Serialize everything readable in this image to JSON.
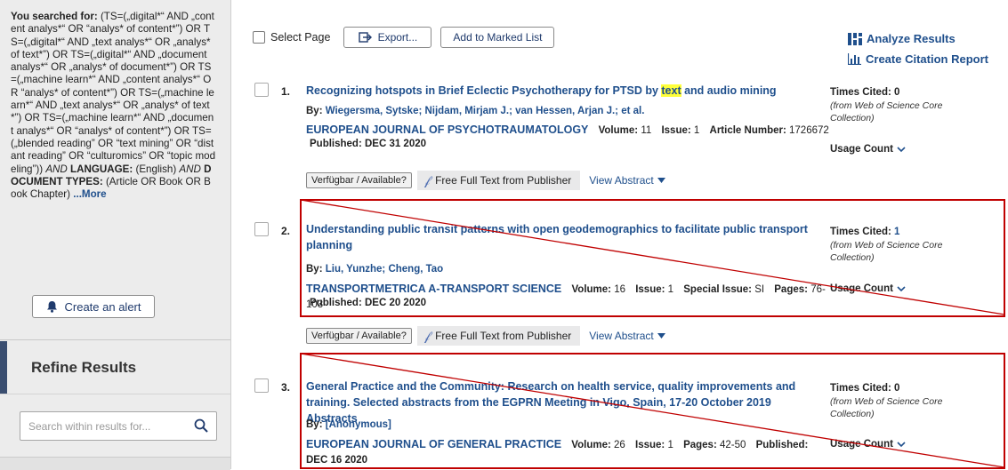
{
  "sidebar": {
    "search_label": "You searched for:",
    "query_parts": [
      {
        "t": " (TS=(„digital*“ AND „content analys*“ OR “analys* of content*”) OR TS=(„digital*“ AND „text analys*“ OR „analys* of text*”) OR TS=(„digital*“ AND „document analys*“ OR „analys* of document*”) OR TS=(„machine learn*“ AND „content analys*“ OR “analys* of content*”) OR TS=(„machine learn*“ AND „text analys*“ OR „analys* of text*”) OR TS=(„machine learn*“ AND „document analys*“ OR “analys* of content*”) OR TS=(„blended reading” OR “text mining” OR “distant reading” OR “culturomics” OR “topic modeling”)) ",
        "s": "n"
      },
      {
        "t": "AND",
        "s": "i"
      },
      {
        "t": " LANGUAGE: ",
        "s": "b"
      },
      {
        "t": "(English) ",
        "s": "n"
      },
      {
        "t": "AND",
        "s": "i"
      },
      {
        "t": " DOCUMENT TYPES: ",
        "s": "b"
      },
      {
        "t": "(Article OR Book OR Book Chapter) ",
        "s": "n"
      }
    ],
    "more_label": "...More",
    "alert_label": "Create an alert",
    "refine_title": "Refine Results",
    "search_placeholder": "Search within results for..."
  },
  "toolbar": {
    "select_page": "Select Page",
    "export_label": "Export...",
    "marked_list_label": "Add to Marked List",
    "analyze_label": "Analyze Results",
    "citation_label": "Create Citation Report"
  },
  "records": [
    {
      "num": "1.",
      "title_before": "Recognizing hotspots in Brief Eclectic Psychotherapy for PTSD by ",
      "title_highlight": "text",
      "title_after": " and audio mining",
      "by_label": "By:",
      "authors": "Wiegersma, Sytske; Nijdam, Mirjam J.; van Hessen, Arjan J.; et al.",
      "journal": "EUROPEAN JOURNAL OF PSYCHOTRAUMATOLOGY",
      "meta": [
        {
          "l": "Volume:",
          "v": "11"
        },
        {
          "l": "Issue:",
          "v": "1"
        },
        {
          "l": "Article Number:",
          "v": "1726672"
        }
      ],
      "published": "Published: DEC 31 2020",
      "times_cited_label": "Times Cited:",
      "times_cited": "0",
      "from": "(from Web of Science Core Collection)",
      "usage": "Usage Count"
    },
    {
      "num": "2.",
      "title": "Understanding public transit patterns with open geodemographics to facilitate public transport planning",
      "by_label": "By:",
      "authors": "Liu, Yunzhe; Cheng, Tao",
      "journal": "TRANSPORTMETRICA A-TRANSPORT SCIENCE",
      "meta": [
        {
          "l": "Volume:",
          "v": "16"
        },
        {
          "l": "Issue:",
          "v": "1"
        },
        {
          "l": "Special Issue:",
          "v": "SI"
        },
        {
          "l": "Pages:",
          "v": "76-103"
        }
      ],
      "published": "Published: DEC 20 2020",
      "times_cited_label": "Times Cited:",
      "times_cited": "1",
      "from": "(from Web of Science Core Collection)",
      "usage": "Usage Count"
    },
    {
      "num": "3.",
      "title": "General Practice and the Community: Research on health service, quality improvements and training. Selected abstracts from the EGPRN Meeting in Vigo, Spain, 17-20 October 2019 Abstracts",
      "by_label": "By:",
      "authors": "[Anonymous]",
      "journal": "EUROPEAN JOURNAL OF GENERAL PRACTICE",
      "meta": [
        {
          "l": "Volume:",
          "v": "26"
        },
        {
          "l": "Issue:",
          "v": "1"
        },
        {
          "l": "Pages:",
          "v": "42-50"
        }
      ],
      "published": "Published: DEC 16 2020",
      "times_cited_label": "Times Cited:",
      "times_cited": "0",
      "from": "(from Web of Science Core Collection)",
      "usage": "Usage Count"
    }
  ],
  "actions": {
    "avail": "Verfügbar / Available?",
    "full_text": "Free Full Text from Publisher",
    "abstract": "View Abstract"
  },
  "colors": {
    "link": "#1f4f8c",
    "annotation": "#c00000",
    "highlight": "#ffff3a"
  }
}
